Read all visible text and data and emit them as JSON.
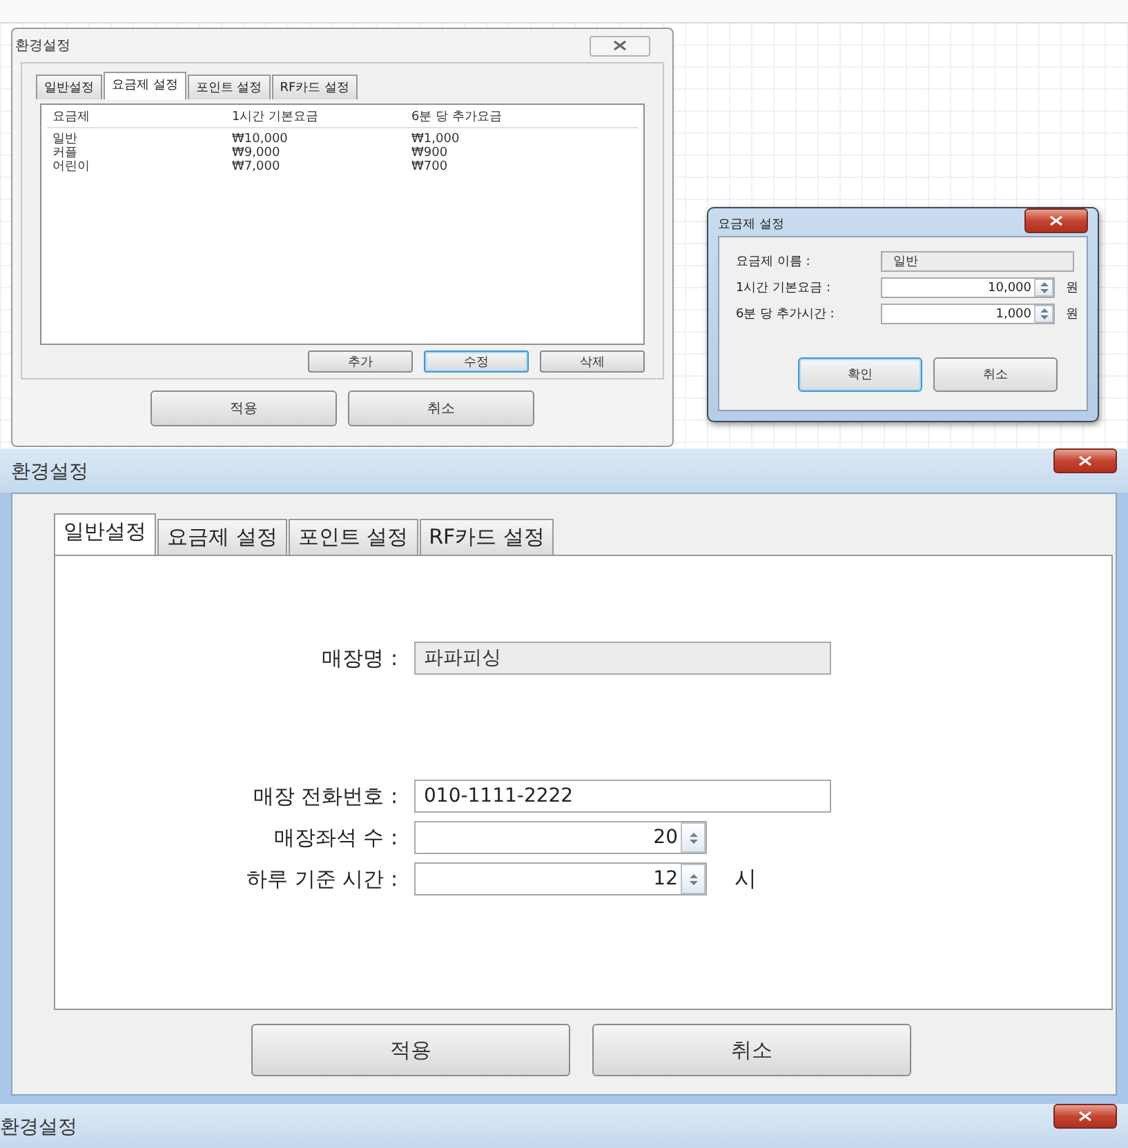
{
  "dialogs": [
    {
      "kind": "list",
      "title": "환경설정",
      "tabs": [
        {
          "label": "일반설정",
          "selected": false
        },
        {
          "label": "요금제 설정",
          "selected": true
        },
        {
          "label": "포인트 설정",
          "selected": false
        },
        {
          "label": "RF카드 설정",
          "selected": false
        }
      ],
      "table": {
        "columns": [
          "요금제",
          "1시간 기본요금",
          "6분 당 추가요금"
        ],
        "rows": [
          [
            "일반",
            "₩10,000",
            "₩1,000"
          ],
          [
            "커플",
            "₩9,000",
            "₩900"
          ],
          [
            "어린이",
            "₩7,000",
            "₩700"
          ]
        ]
      },
      "list_buttons": [
        {
          "label": "추가",
          "focused": false
        },
        {
          "label": "수정",
          "focused": true
        },
        {
          "label": "삭제",
          "focused": false
        }
      ],
      "buttons": [
        {
          "label": "적용",
          "focused": false
        },
        {
          "label": "취소",
          "focused": false
        }
      ]
    },
    {
      "kind": "form",
      "title": "요금제 설정",
      "fields": [
        {
          "kind": "readonly",
          "label": "요금제 이름 :",
          "value": "일반"
        },
        {
          "kind": "spin",
          "label": "1시간 기본요금 :",
          "value": "10,000",
          "unit": "원"
        },
        {
          "kind": "spin",
          "label": "6분 당 추가시간 :",
          "value": "1,000",
          "unit": "원"
        }
      ],
      "buttons": [
        {
          "label": "확인",
          "focused": true
        },
        {
          "label": "취소",
          "focused": false
        }
      ]
    },
    {
      "kind": "settings",
      "title": "환경설정",
      "tabs": [
        {
          "label": "일반설정",
          "selected": true
        },
        {
          "label": "요금제 설정",
          "selected": false
        },
        {
          "label": "포인트 설정",
          "selected": false
        },
        {
          "label": "RF카드 설정",
          "selected": false
        }
      ],
      "fields": [
        {
          "kind": "readonly",
          "label": "매장명 :",
          "value": "파파피싱"
        },
        {
          "kind": "text",
          "label": "매장 전화번호 :",
          "value": "010-1111-2222"
        },
        {
          "kind": "spin",
          "label": "매장좌석 수 :",
          "value": "20"
        },
        {
          "kind": "spin",
          "label": "하루 기준 시간 :",
          "value": "12",
          "unit": "시"
        }
      ],
      "buttons": [
        {
          "label": "적용",
          "focused": false
        },
        {
          "label": "취소",
          "focused": false
        }
      ]
    },
    {
      "kind": "titlebar",
      "title": "환경설정"
    }
  ]
}
